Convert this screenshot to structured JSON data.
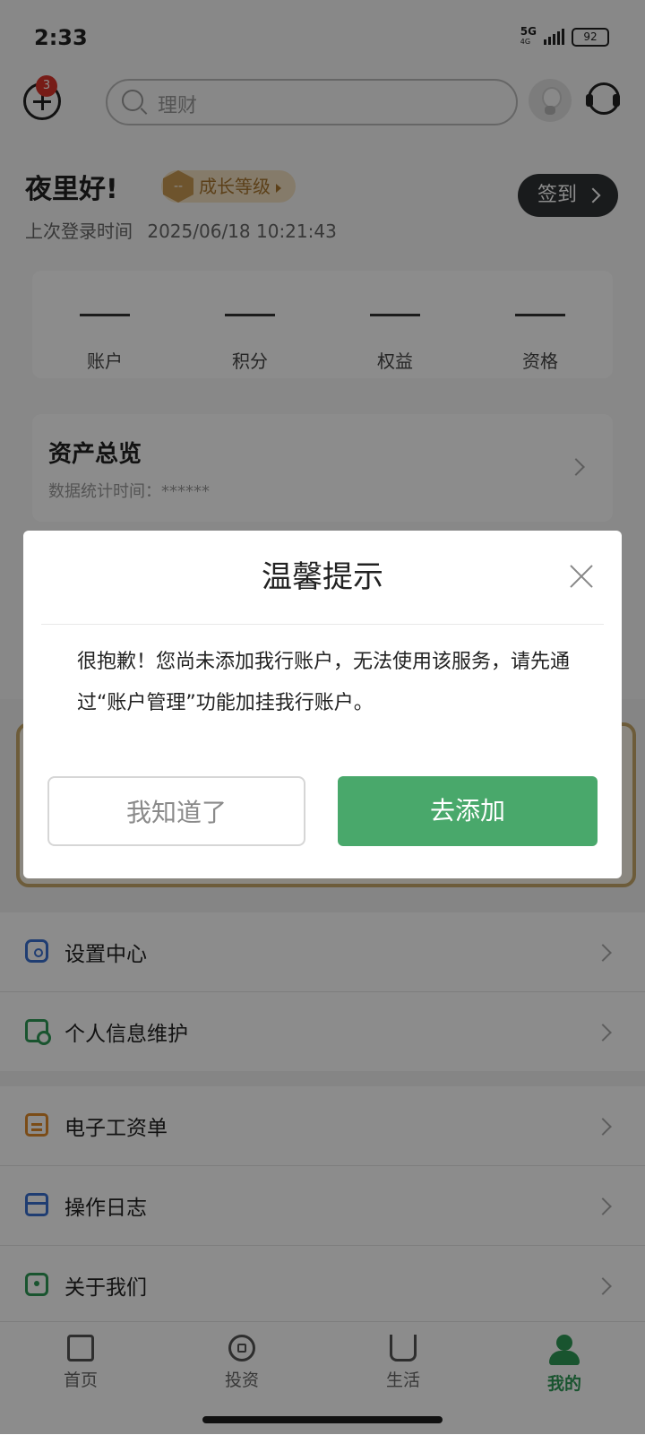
{
  "status_bar": {
    "time": "2:33",
    "network": "5G",
    "network_sub": "4G",
    "battery": "92"
  },
  "header": {
    "add_badge": "3",
    "search_placeholder": "理财"
  },
  "greeting": {
    "text": "夜里好!",
    "growth_level": "成长等级",
    "growth_level_icon_text": "--",
    "checkin": "签到"
  },
  "last_login": {
    "label": "上次登录时间",
    "value": "2025/06/18  10:21:43"
  },
  "stats": [
    {
      "label": "账户"
    },
    {
      "label": "积分"
    },
    {
      "label": "权益"
    },
    {
      "label": "资格"
    }
  ],
  "assets": {
    "title": "资产总览",
    "time_label": "数据统计时间：",
    "time_value": "******"
  },
  "settings_group_1": [
    {
      "label": "设置中心",
      "icon": "lock-icon"
    },
    {
      "label": "个人信息维护",
      "icon": "person-card-icon"
    }
  ],
  "settings_group_2": [
    {
      "label": "电子工资单",
      "icon": "payslip-icon"
    },
    {
      "label": "操作日志",
      "icon": "log-icon"
    },
    {
      "label": "关于我们",
      "icon": "about-icon"
    }
  ],
  "tabbar": {
    "items": [
      {
        "label": "首页",
        "icon": "home-icon"
      },
      {
        "label": "投资",
        "icon": "invest-icon"
      },
      {
        "label": "生活",
        "icon": "life-icon"
      },
      {
        "label": "我的",
        "icon": "mine-icon",
        "active": true
      }
    ]
  },
  "dialog": {
    "title": "温馨提示",
    "message": "很抱歉！您尚未添加我行账户，无法使用该服务，请先通过“账户管理”功能加挂我行账户。",
    "cancel_label": "我知道了",
    "confirm_label": "去添加"
  },
  "colors": {
    "accent": "#49a86b",
    "badge": "#d9332a",
    "gold": "#c99a52"
  }
}
